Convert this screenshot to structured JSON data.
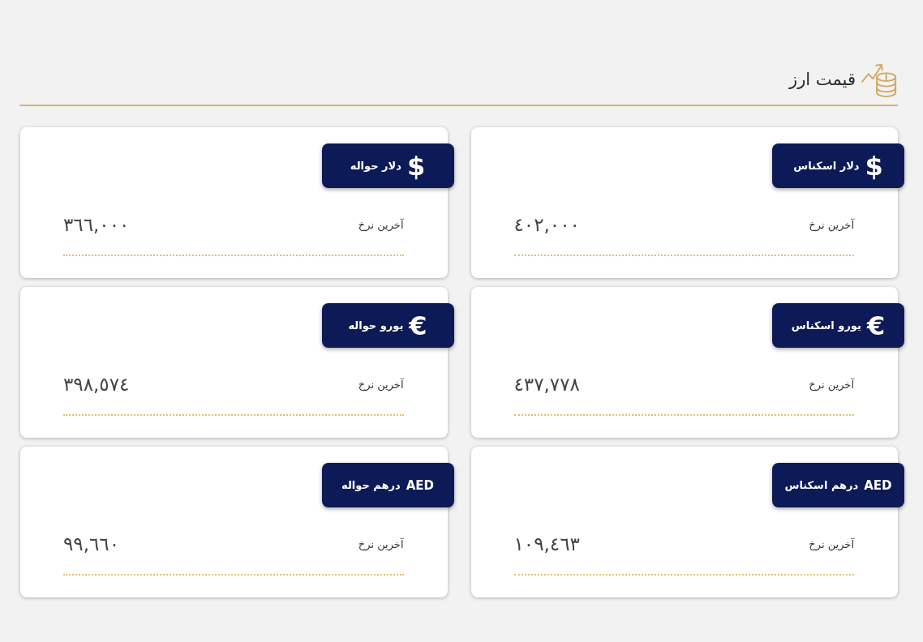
{
  "header": {
    "title": "قیمت ارز"
  },
  "cards": [
    {
      "symbol": {
        "text": "$",
        "kind": "glyph"
      },
      "name": "دلار اسکناس",
      "label": "آخرین نرخ",
      "value": "٤٠٢,٠٠٠"
    },
    {
      "symbol": {
        "text": "$",
        "kind": "glyph"
      },
      "name": "دلار حواله",
      "label": "آخرین نرخ",
      "value": "٣٦٦,٠٠٠"
    },
    {
      "symbol": {
        "text": "€",
        "kind": "glyph"
      },
      "name": "یورو اسکناس",
      "label": "آخرین نرخ",
      "value": "٤٣٧,٧٧٨"
    },
    {
      "symbol": {
        "text": "€",
        "kind": "glyph"
      },
      "name": "یورو حواله",
      "label": "آخرین نرخ",
      "value": "٣٩٨,٥٧٤"
    },
    {
      "symbol": {
        "text": "AED",
        "kind": "code"
      },
      "name": "درهم اسکناس",
      "label": "آخرین نرخ",
      "value": "١٠٩,٤٦٣"
    },
    {
      "symbol": {
        "text": "AED",
        "kind": "code"
      },
      "name": "درهم حواله",
      "label": "آخرین نرخ",
      "value": "٩٩,٦٦٠"
    }
  ]
}
